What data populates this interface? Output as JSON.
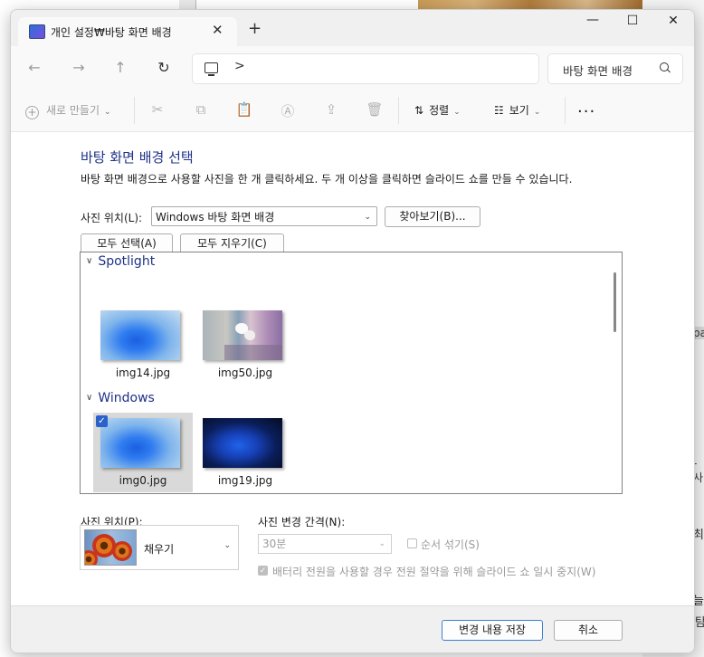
{
  "window": {
    "tab_title": "개인 설정₩바탕 화면 배경"
  },
  "address": {
    "separator": ">"
  },
  "search": {
    "text": "바탕 화면 배경"
  },
  "toolbar": {
    "new_label": "새로 만들기",
    "sort_label": "정렬",
    "view_label": "보기",
    "more_label": "..."
  },
  "content": {
    "heading": "바탕 화면 배경 선택",
    "description": "바탕 화면 배경으로 사용할 사진을 한 개 클릭하세요. 두 개 이상을 클릭하면 슬라이드 쇼를 만들 수 있습니다.",
    "picture_location_label": "사진 위치(L):",
    "picture_location_value": "Windows 바탕 화면 배경",
    "browse_button": "찾아보기(B)...",
    "select_all_button": "모두 선택(A)",
    "clear_all_button": "모두 지우기(C)",
    "groups": [
      {
        "name": "Spotlight",
        "items": [
          {
            "file": "img14.jpg"
          },
          {
            "file": "img50.jpg"
          }
        ]
      },
      {
        "name": "Windows",
        "items": [
          {
            "file": "img0.jpg",
            "selected": true
          },
          {
            "file": "img19.jpg"
          }
        ]
      }
    ],
    "picture_position_label": "사진 위치(P):",
    "picture_position_value": "채우기",
    "change_interval_label": "사진 변경 간격(N):",
    "change_interval_value": "30분",
    "shuffle_label": "순서 섞기(S)",
    "battery_label": "배터리 전원을 사용할 경우 전원 절약을 위해 슬라이드 쇼 일시 중지(W)"
  },
  "footer": {
    "save_button": "변경 내용 저장",
    "cancel_button": "취소"
  },
  "background": {
    "frag_1": "pap",
    "frag_2": "- 사",
    "frag_3": "최",
    "frag_4": "늘",
    "frag_5": "탐"
  },
  "colors": {
    "accent": "#1e3287",
    "selection": "#d9d9d9",
    "check": "#2b62c9"
  }
}
